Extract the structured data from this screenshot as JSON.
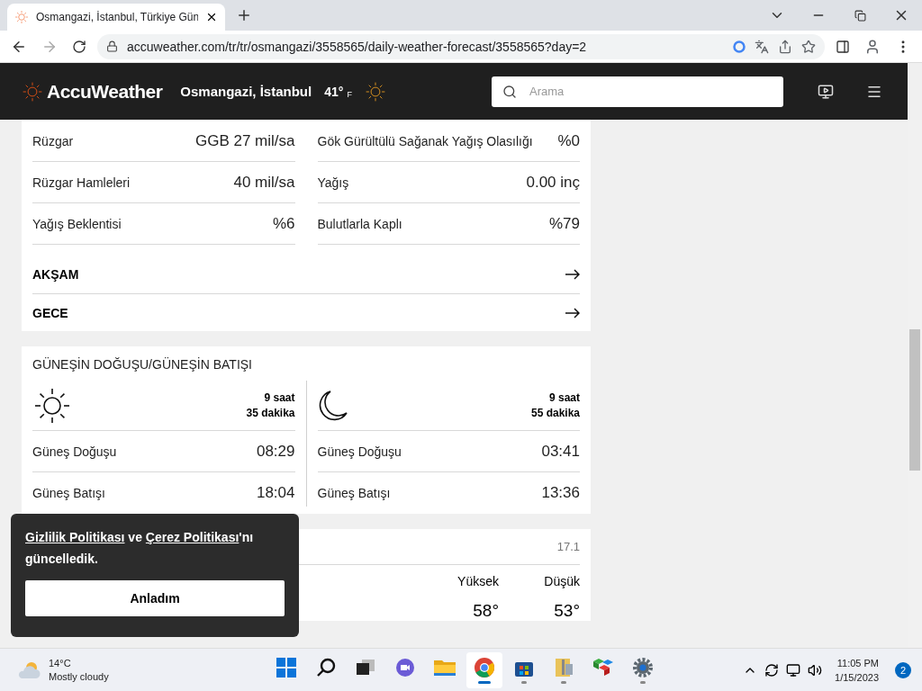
{
  "browser": {
    "tab_title": "Osmangazi, İstanbul, Türkiye Gün",
    "url": "accuweather.com/tr/tr/osmangazi/3558565/daily-weather-forecast/3558565?day=2"
  },
  "header": {
    "logo": "AccuWeather",
    "location": "Osmangazi, İstanbul",
    "temp": "41°",
    "unit": "F",
    "search_placeholder": "Arama"
  },
  "details": [
    {
      "label": "Rüzgar",
      "value": "GGB 27 mil/sa"
    },
    {
      "label": "Gök Gürültülü Sağanak Yağış Olasılığı",
      "value": "%0"
    },
    {
      "label": "Rüzgar Hamleleri",
      "value": "40 mil/sa"
    },
    {
      "label": "Yağış",
      "value": "0.00 inç"
    },
    {
      "label": "Yağış Beklentisi",
      "value": "%6"
    },
    {
      "label": "Bulutlarla Kaplı",
      "value": "%79"
    }
  ],
  "sections": [
    {
      "label": "AKŞAM"
    },
    {
      "label": "GECE"
    }
  ],
  "sun_moon": {
    "title": "GÜNEŞİN DOĞUŞU/GÜNEŞİN BATIŞI",
    "panels": [
      {
        "kind": "sun",
        "hours": "9 saat",
        "minutes": "35 dakika",
        "rows": [
          {
            "label": "Güneş Doğuşu",
            "value": "08:29"
          },
          {
            "label": "Güneş Batışı",
            "value": "18:04"
          }
        ]
      },
      {
        "kind": "moon",
        "hours": "9 saat",
        "minutes": "55 dakika",
        "rows": [
          {
            "label": "Güneş Doğuşu",
            "value": "03:41"
          },
          {
            "label": "Güneş Batışı",
            "value": "13:36"
          }
        ]
      }
    ]
  },
  "history": {
    "date": "17.1",
    "columns": [
      "Yüksek",
      "Düşük"
    ],
    "values": [
      "58°",
      "53°"
    ]
  },
  "cookie": {
    "link_1": "Gizlilik Politikası",
    "joiner": " ve ",
    "link_2": "Çerez Politikası",
    "rest": "'nı güncelledik.",
    "button": "Anladım"
  },
  "taskbar": {
    "temp": "14°C",
    "condition": "Mostly cloudy",
    "apps": [
      {
        "kind": "start",
        "running": false,
        "selected": false
      },
      {
        "kind": "search",
        "running": false,
        "selected": false
      },
      {
        "kind": "taskview",
        "running": false,
        "selected": false
      },
      {
        "kind": "chat",
        "running": false,
        "selected": false
      },
      {
        "kind": "folder",
        "running": false,
        "selected": false
      },
      {
        "kind": "chrome",
        "running": true,
        "selected": true
      },
      {
        "kind": "store",
        "running": true,
        "selected": false
      },
      {
        "kind": "archive",
        "running": true,
        "selected": false
      },
      {
        "kind": "cubes",
        "running": false,
        "selected": false
      },
      {
        "kind": "settings",
        "running": true,
        "selected": false
      }
    ],
    "time": "11:05 PM",
    "date": "1/15/2023",
    "badge": "2"
  }
}
